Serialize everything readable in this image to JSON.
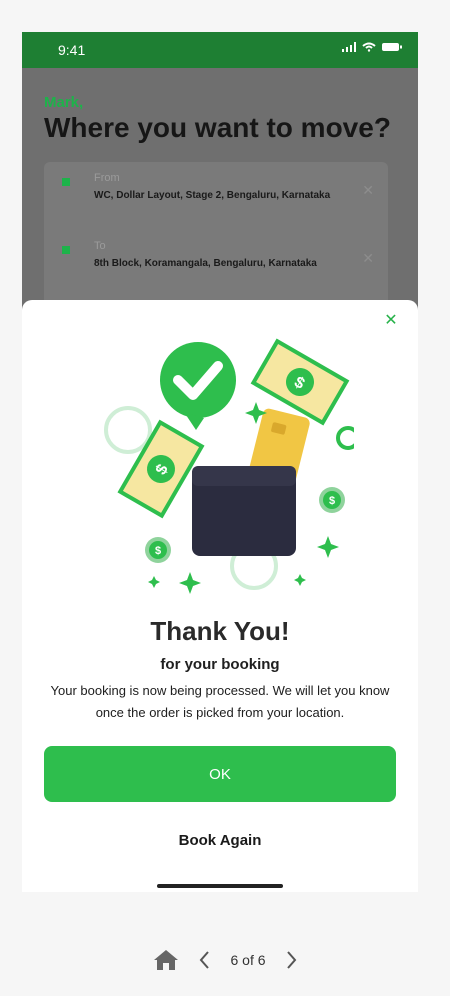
{
  "status": {
    "time": "9:41"
  },
  "home": {
    "greeting": "Mark,",
    "question": "Where you want to move?",
    "from": {
      "label": "From",
      "value": "WC, Dollar Layout, Stage 2, Bengaluru, Karnataka"
    },
    "to": {
      "label": "To",
      "value": "8th Block, Koramangala, Bengaluru, Karnataka"
    }
  },
  "modal": {
    "title": "Thank You!",
    "subtitle": "for your booking",
    "description": "Your booking  is now being processed. We will let you know once the order is picked from your location.",
    "ok_label": "OK",
    "book_again_label": "Book Again"
  },
  "pager": {
    "label": "6 of 6"
  },
  "colors": {
    "brand": "#1e7f33",
    "accent": "#2ebe4d"
  },
  "icons": [
    "signal-icon",
    "wifi-icon",
    "battery-icon",
    "close-icon",
    "check-bubble-icon",
    "wallet-icon",
    "money-icon",
    "home-icon",
    "chevron-left-icon",
    "chevron-right-icon"
  ]
}
